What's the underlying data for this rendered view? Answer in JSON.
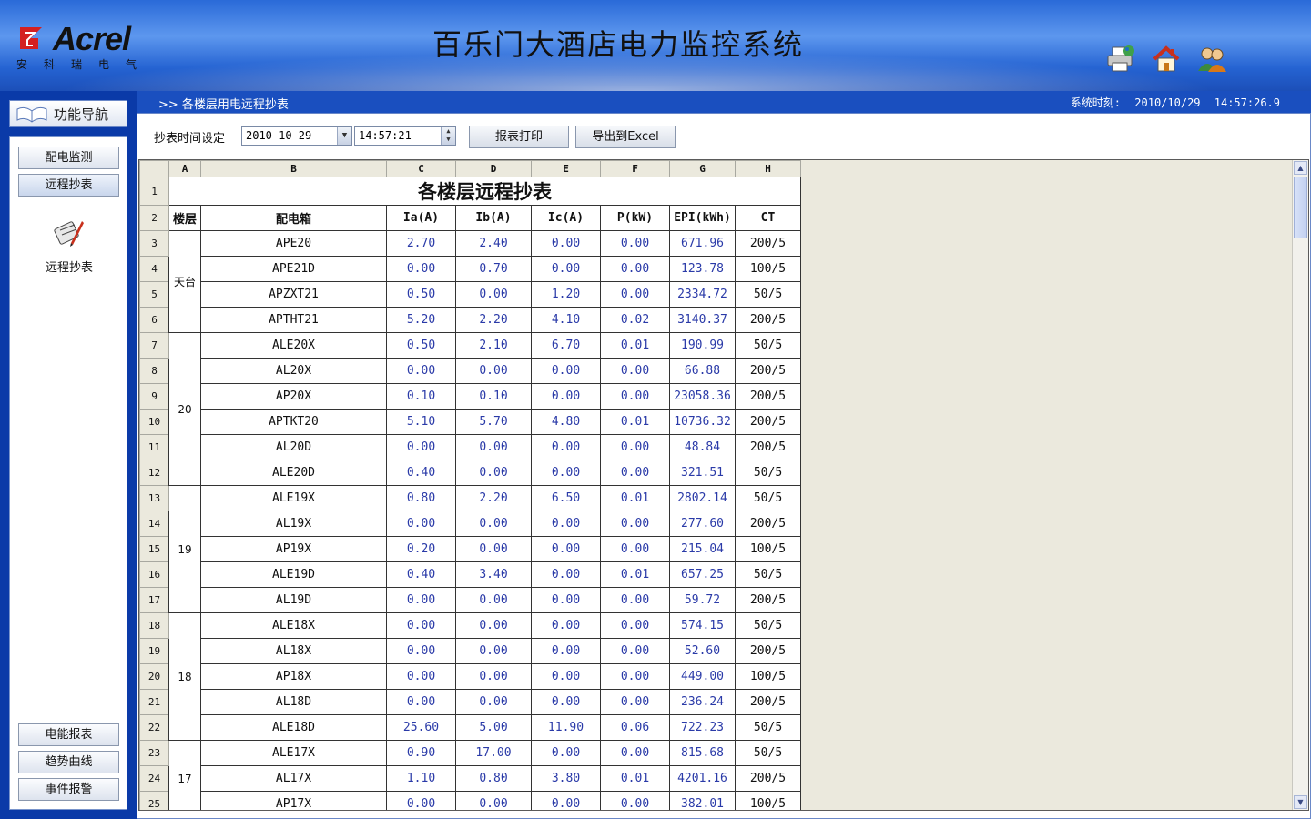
{
  "header": {
    "logo_text": "Acrel",
    "logo_sub": "安科瑞电气",
    "title": "百乐门大酒店电力监控系统",
    "icons": [
      "printer-icon",
      "home-icon",
      "users-icon"
    ]
  },
  "infobar": {
    "breadcrumb": ">> 各楼层用电远程抄表",
    "clock_label": "系统时刻:",
    "clock_date": "2010/10/29",
    "clock_time": "14:57:26.9"
  },
  "sidebar": {
    "nav_title": "功能导航",
    "top_buttons": [
      "配电监测",
      "远程抄表"
    ],
    "tool_label": "远程抄表",
    "bottom_buttons": [
      "电能报表",
      "趋势曲线",
      "事件报警"
    ]
  },
  "controls": {
    "label": "抄表时间设定",
    "date_value": "2010-10-29",
    "time_value": "14:57:21",
    "print_label": "报表打印",
    "export_label": "导出到Excel"
  },
  "sheet": {
    "col_letters": [
      "A",
      "B",
      "C",
      "D",
      "E",
      "F",
      "G",
      "H"
    ],
    "title": "各楼层远程抄表",
    "headers": [
      "楼层",
      "配电箱",
      "Ia(A)",
      "Ib(A)",
      "Ic(A)",
      "P(kW)",
      "EPI(kWh)",
      "CT"
    ],
    "groups": [
      {
        "floor": "天台",
        "start": 0,
        "span": 4
      },
      {
        "floor": "20",
        "start": 4,
        "span": 6
      },
      {
        "floor": "19",
        "start": 10,
        "span": 5
      },
      {
        "floor": "18",
        "start": 15,
        "span": 5
      },
      {
        "floor": "17",
        "start": 20,
        "span": 3
      }
    ],
    "rows": [
      [
        "APE20",
        "2.70",
        "2.40",
        "0.00",
        "0.00",
        "671.96",
        "200/5"
      ],
      [
        "APE21D",
        "0.00",
        "0.70",
        "0.00",
        "0.00",
        "123.78",
        "100/5"
      ],
      [
        "APZXT21",
        "0.50",
        "0.00",
        "1.20",
        "0.00",
        "2334.72",
        "50/5"
      ],
      [
        "APTHT21",
        "5.20",
        "2.20",
        "4.10",
        "0.02",
        "3140.37",
        "200/5"
      ],
      [
        "ALE20X",
        "0.50",
        "2.10",
        "6.70",
        "0.01",
        "190.99",
        "50/5"
      ],
      [
        "AL20X",
        "0.00",
        "0.00",
        "0.00",
        "0.00",
        "66.88",
        "200/5"
      ],
      [
        "AP20X",
        "0.10",
        "0.10",
        "0.00",
        "0.00",
        "23058.36",
        "200/5"
      ],
      [
        "APTKT20",
        "5.10",
        "5.70",
        "4.80",
        "0.01",
        "10736.32",
        "200/5"
      ],
      [
        "AL20D",
        "0.00",
        "0.00",
        "0.00",
        "0.00",
        "48.84",
        "200/5"
      ],
      [
        "ALE20D",
        "0.40",
        "0.00",
        "0.00",
        "0.00",
        "321.51",
        "50/5"
      ],
      [
        "ALE19X",
        "0.80",
        "2.20",
        "6.50",
        "0.01",
        "2802.14",
        "50/5"
      ],
      [
        "AL19X",
        "0.00",
        "0.00",
        "0.00",
        "0.00",
        "277.60",
        "200/5"
      ],
      [
        "AP19X",
        "0.20",
        "0.00",
        "0.00",
        "0.00",
        "215.04",
        "100/5"
      ],
      [
        "ALE19D",
        "0.40",
        "3.40",
        "0.00",
        "0.01",
        "657.25",
        "50/5"
      ],
      [
        "AL19D",
        "0.00",
        "0.00",
        "0.00",
        "0.00",
        "59.72",
        "200/5"
      ],
      [
        "ALE18X",
        "0.00",
        "0.00",
        "0.00",
        "0.00",
        "574.15",
        "50/5"
      ],
      [
        "AL18X",
        "0.00",
        "0.00",
        "0.00",
        "0.00",
        "52.60",
        "200/5"
      ],
      [
        "AP18X",
        "0.00",
        "0.00",
        "0.00",
        "0.00",
        "449.00",
        "100/5"
      ],
      [
        "AL18D",
        "0.00",
        "0.00",
        "0.00",
        "0.00",
        "236.24",
        "200/5"
      ],
      [
        "ALE18D",
        "25.60",
        "5.00",
        "11.90",
        "0.06",
        "722.23",
        "50/5"
      ],
      [
        "ALE17X",
        "0.90",
        "17.00",
        "0.00",
        "0.00",
        "815.68",
        "50/5"
      ],
      [
        "AL17X",
        "1.10",
        "0.80",
        "3.80",
        "0.01",
        "4201.16",
        "200/5"
      ],
      [
        "AP17X",
        "0.00",
        "0.00",
        "0.00",
        "0.00",
        "382.01",
        "100/5"
      ]
    ]
  },
  "colors": {
    "header_blue": "#2a6ad8",
    "sidebar_blue": "#0a3aa8",
    "value_blue": "#2a3aa8",
    "logo_red": "#d42020"
  }
}
